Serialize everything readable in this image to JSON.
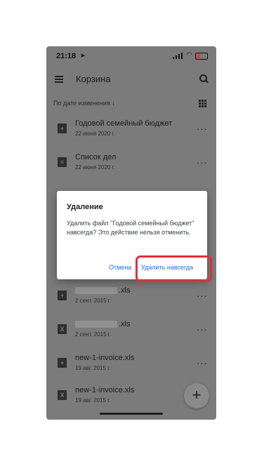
{
  "status_bar": {
    "time": "21:18"
  },
  "app_bar": {
    "title": "Корзина"
  },
  "sort": {
    "label": "По дате изменения ↓"
  },
  "files": [
    {
      "name": "Годовой семейный бюджет",
      "date": "22 июня 2020 г.",
      "type": "sheet"
    },
    {
      "name": "Список дел",
      "date": "22 июня 2020 г.",
      "type": "doc"
    },
    {
      "name": ".xls",
      "date": "2 сент. 2015 г.",
      "type": "sheet"
    },
    {
      "name": ".xls",
      "date": "2 сент. 2015 г.",
      "type": "excel"
    },
    {
      "name": "new-1-invoice.xls",
      "date": "19 авг. 2015 г.",
      "type": "sheet"
    },
    {
      "name": "new-1-invoice.xls",
      "date": "19 авг. 2015 г.",
      "type": "excel"
    }
  ],
  "dialog": {
    "title": "Удаление",
    "message": "Удалить файл \"Годовой семейный бюджет\" навсегда? Это действие нельзя отменить.",
    "cancel": "Отмена",
    "confirm": "Удалить навсегда"
  },
  "fab": {
    "label": "+"
  },
  "colors": {
    "accent": "#1a73e8",
    "highlight": "#e0303e",
    "scrim": "#7b7b7b"
  }
}
